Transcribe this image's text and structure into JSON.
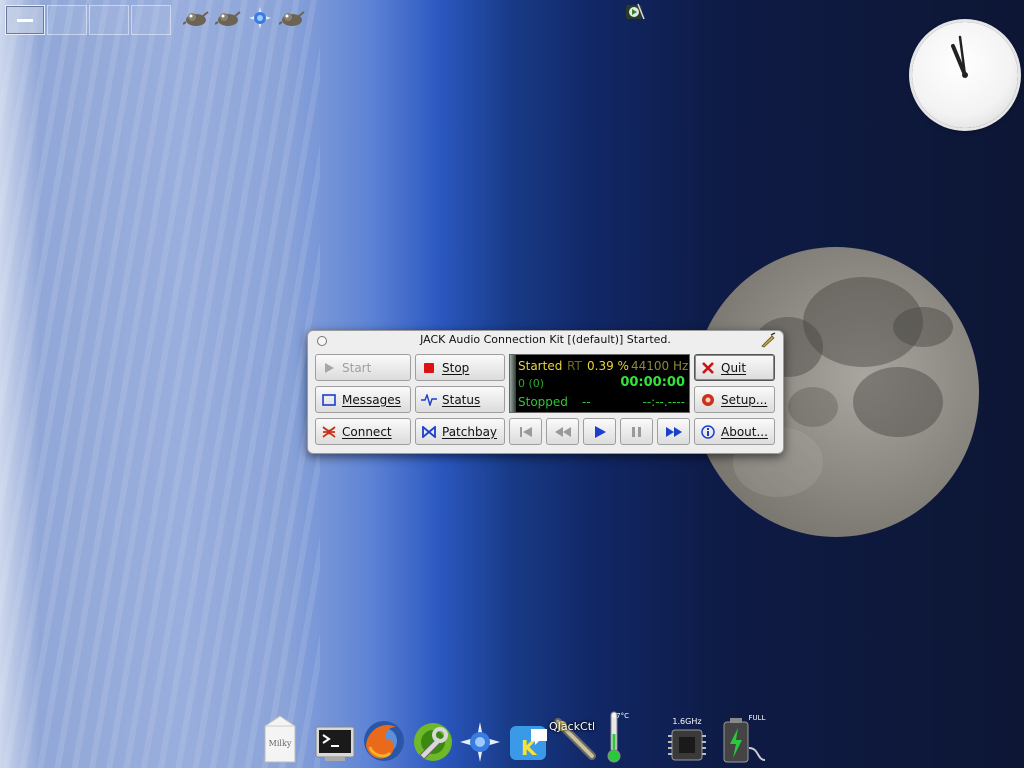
{
  "desktop": {
    "pager_count": 4,
    "active_desktop": 1
  },
  "jack_window": {
    "title": "JACK Audio Connection Kit [(default)] Started.",
    "buttons": {
      "start": "Start",
      "stop": "Stop",
      "quit": "Quit",
      "messages": "Messages",
      "status": "Status",
      "setup": "Setup...",
      "connect": "Connect",
      "patchbay": "Patchbay",
      "about": "About..."
    },
    "display": {
      "server_state": "Started",
      "rt_label": "RT",
      "dsp_load": "0.39 %",
      "sample_rate": "44100 Hz",
      "xruns": "0 (0)",
      "time": "00:00:00",
      "transport_state": "Stopped",
      "bpm": "--",
      "bbt": "--:--.----"
    },
    "transport": [
      "rewind-to-start",
      "rewind",
      "play",
      "pause",
      "fast-forward"
    ]
  },
  "dock": {
    "items": [
      "milky",
      "terminal",
      "firefox",
      "kde-control",
      "konqueror",
      "k-app",
      "QJackCtl",
      "thermometer",
      "cpu-monitor",
      "battery"
    ],
    "qjackctl_label": "QJackCtl",
    "temp_label": "47°C",
    "cpu_label": "1.6GHz",
    "battery_label": "FULL",
    "milky_label": "Milky"
  },
  "colors": {
    "display_bg": "#000000",
    "display_yellow": "#e8d33a",
    "display_green": "#33e33a",
    "stop_red": "#dd1111",
    "play_blue": "#1a3fd0"
  }
}
